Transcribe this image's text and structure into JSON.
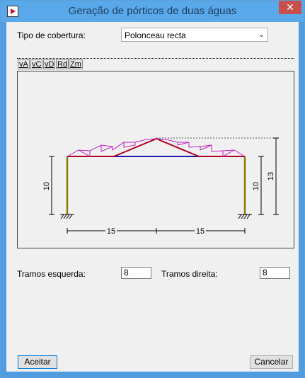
{
  "window": {
    "title": "Geração de pórticos de duas águas",
    "close_glyph": "✕"
  },
  "form": {
    "roof_type_label": "Tipo de cobertura:",
    "roof_type_value": "Polonceau recta",
    "left_spans_label": "Tramos esquerda:",
    "left_spans_value": "8",
    "right_spans_label": "Tramos direita:",
    "right_spans_value": "8"
  },
  "view_tools": [
    "vA",
    "vC",
    "vD",
    "Rd",
    "Zm"
  ],
  "drawing": {
    "left_height": "10",
    "right_height": "10",
    "ridge_height": "13",
    "left_span": "15",
    "right_span": "15"
  },
  "buttons": {
    "accept": "Aceitar",
    "cancel": "Cancelar"
  },
  "colors": {
    "column": "#8a7a00",
    "rafter": "#b00020",
    "tie": "#1a1ab0",
    "diagonal": "#c020c0",
    "dim": "#000000"
  }
}
